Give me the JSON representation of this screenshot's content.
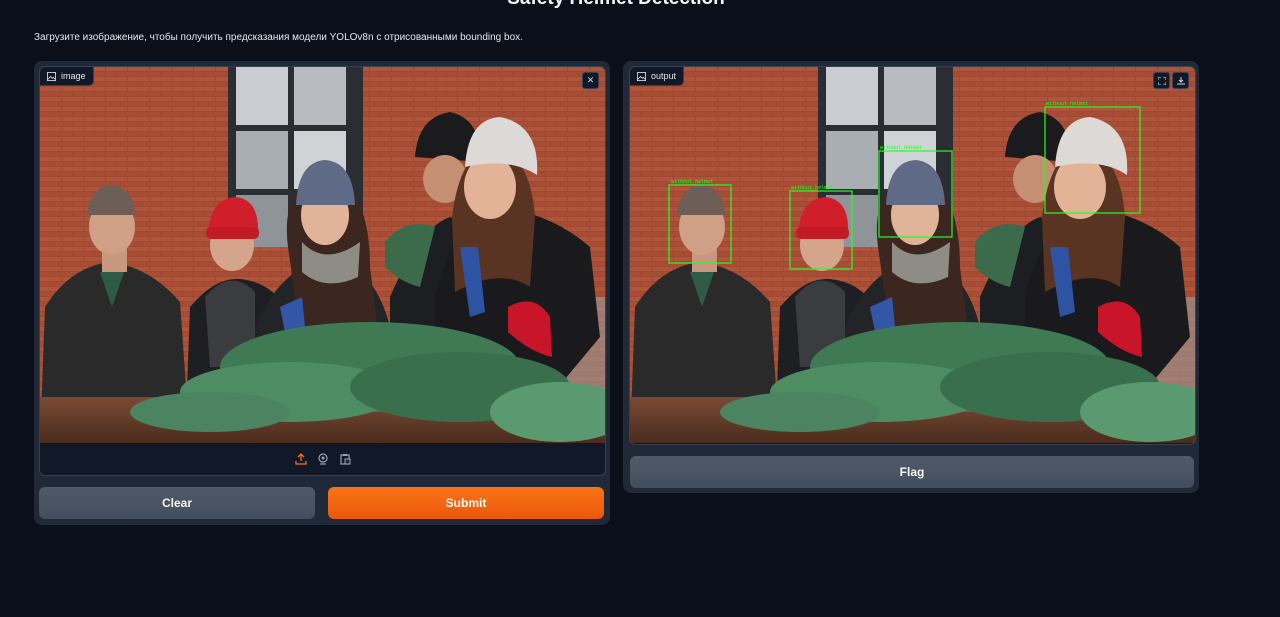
{
  "page": {
    "title": "Safety Helmet Detection",
    "description": "Загрузите изображение, чтобы получить предсказания модели YOLOv8n с отрисованными bounding box."
  },
  "input_panel": {
    "label": "image",
    "icons": [
      "image-icon",
      "close-icon",
      "upload-icon",
      "webcam-icon",
      "clipboard-icon"
    ]
  },
  "output_panel": {
    "label": "output",
    "icons": [
      "image-icon",
      "fullscreen-icon",
      "download-icon"
    ]
  },
  "buttons": {
    "clear": "Clear",
    "submit": "Submit",
    "flag": "Flag"
  },
  "colors": {
    "background": "#0b0f19",
    "panel": "#1f2937",
    "accent": "#f97316",
    "detection_box": "#22ff22"
  },
  "detections": [
    {
      "label": "head",
      "text": "without_helmet"
    },
    {
      "label": "head",
      "text": "without_helmet"
    },
    {
      "label": "head",
      "text": "without_helmet"
    },
    {
      "label": "head",
      "text": "without_helmet"
    }
  ]
}
